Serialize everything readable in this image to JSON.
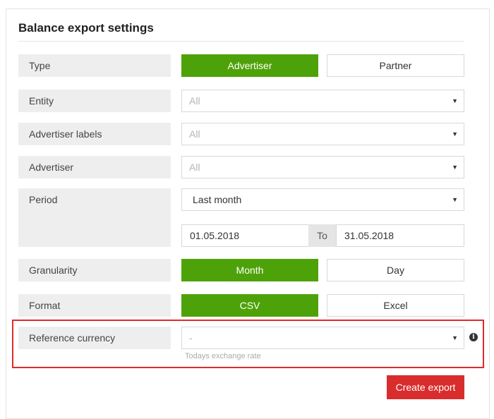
{
  "title": "Balance export settings",
  "rows": {
    "type": {
      "label": "Type",
      "options": [
        "Advertiser",
        "Partner"
      ],
      "selected": "Advertiser"
    },
    "entity": {
      "label": "Entity",
      "value": "All"
    },
    "advertiser_labels": {
      "label": "Advertiser labels",
      "value": "All"
    },
    "advertiser": {
      "label": "Advertiser",
      "value": "All"
    },
    "period": {
      "label": "Period",
      "value": "Last month",
      "from": "01.05.2018",
      "to_label": "To",
      "to": "31.05.2018"
    },
    "granularity": {
      "label": "Granularity",
      "options": [
        "Month",
        "Day"
      ],
      "selected": "Month"
    },
    "format": {
      "label": "Format",
      "options": [
        "CSV",
        "Excel"
      ],
      "selected": "CSV"
    },
    "reference_currency": {
      "label": "Reference currency",
      "value": "-",
      "hint": "Todays exchange rate"
    }
  },
  "icons": {
    "info": "info-icon",
    "caret": "chevron-down-icon"
  },
  "create_label": "Create export",
  "colors": {
    "accent_green": "#4ea209",
    "create_red": "#d92c2c",
    "highlight_red": "#e02a2a"
  }
}
